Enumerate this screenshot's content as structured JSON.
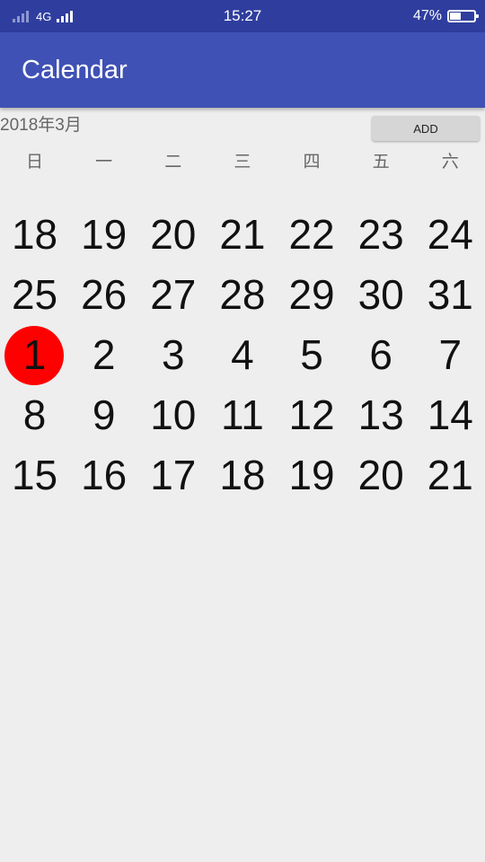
{
  "status_bar": {
    "network": "4G",
    "time": "15:27",
    "battery_percent": "47%",
    "battery_level": 0.47
  },
  "app_bar": {
    "title": "Calendar"
  },
  "month_label": "2018年3月",
  "add_button_label": "ADD",
  "weekdays": [
    "日",
    "一",
    "二",
    "三",
    "四",
    "五",
    "六"
  ],
  "weeks": [
    [
      "18",
      "19",
      "20",
      "21",
      "22",
      "23",
      "24"
    ],
    [
      "25",
      "26",
      "27",
      "28",
      "29",
      "30",
      "31"
    ],
    [
      "1",
      "2",
      "3",
      "4",
      "5",
      "6",
      "7"
    ],
    [
      "8",
      "9",
      "10",
      "11",
      "12",
      "13",
      "14"
    ],
    [
      "15",
      "16",
      "17",
      "18",
      "19",
      "20",
      "21"
    ]
  ],
  "selected_day": "1",
  "colors": {
    "status_bar": "#2f3e9e",
    "app_bar": "#3f51b5",
    "selected_circle": "#ff0000",
    "background": "#eeeeee"
  }
}
